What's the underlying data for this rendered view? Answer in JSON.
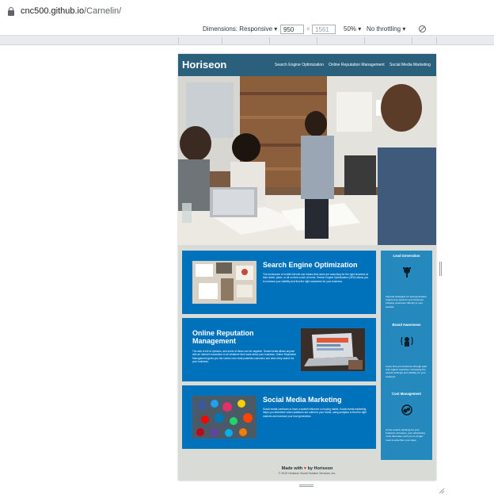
{
  "browser": {
    "url_host": "cnc500.github.io",
    "url_path": "/Carnelin/"
  },
  "devtools": {
    "dimensions_label": "Dimensions: Responsive",
    "width_value": "950",
    "times": "×",
    "height_value": "1561",
    "zoom": "50%",
    "throttle": "No throttling"
  },
  "site": {
    "logo": "Horiseon",
    "nav": [
      "Search Engine Optimization",
      "Online Reputation Management",
      "Social Media Marketing"
    ],
    "cards": [
      {
        "title": "Search Engine Optimization",
        "text": "The dominance of mobile internet use means that users are searching for the right business at their street, place, or all on their couch at home. Search Engine Optimization (SEO) allows you to increase your visibility and find the right customers for your business."
      },
      {
        "title": "Online Reputation Management",
        "text": "The web is full of opinions, and some of these can be negative. Social media allows anyone with an internet connection to air whatever their want about your business. Online Reputation Management gives you the control over what potential customers see when they search for your business."
      },
      {
        "title": "Social Media Marketing",
        "text": "Social media continues to have a sizable influence on buying habits. Social media marketing helps you determine which platforms are suited to your brand, using analytics to find the right markets and increase your lead generation."
      }
    ],
    "benefits": [
      {
        "title": "Lead Generation",
        "text": "Inbound strategies for lead generation require less work for your business, bringing customers directly to your website."
      },
      {
        "title": "Brand Awareness",
        "text": "Users find your business through paid and organic searches, increasing the search rankings and visibility for your business."
      },
      {
        "title": "Cost Management",
        "text": "As the search rankings for your business increases, your advertising costs decrease, and you no longer need to advertise your ways."
      }
    ],
    "footer": {
      "made_prefix": "Made with",
      "made_suffix": "by Horiseon",
      "copyright": "© 2019 Horiseon Social Solution Services, Inc."
    }
  },
  "colors": {
    "header": "#2a607c",
    "card": "#0072bb",
    "benefits": "#2589bd"
  }
}
